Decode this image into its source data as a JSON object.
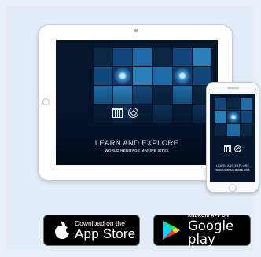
{
  "hero": {
    "ipad_screen": {
      "title": "LEARN AND EXPLORE",
      "subtitle": "WORLD HERITAGE MARINE SITES"
    },
    "iphone_screen": {
      "title": "LEARN AND EXPLORE",
      "subtitle": "WORLD HERITAGE MARINE SITES"
    }
  },
  "badges": {
    "app_store": {
      "icon": "apple-logo-icon",
      "line1": "Download on the",
      "line2": "App Store"
    },
    "google_play": {
      "icon": "google-play-icon",
      "line1": "ANDROID APP ON",
      "line2": "Google play"
    }
  },
  "colors": {
    "page_background": "#e8f1fa",
    "screen_background": "#06162b",
    "badge_background": "#000000"
  }
}
